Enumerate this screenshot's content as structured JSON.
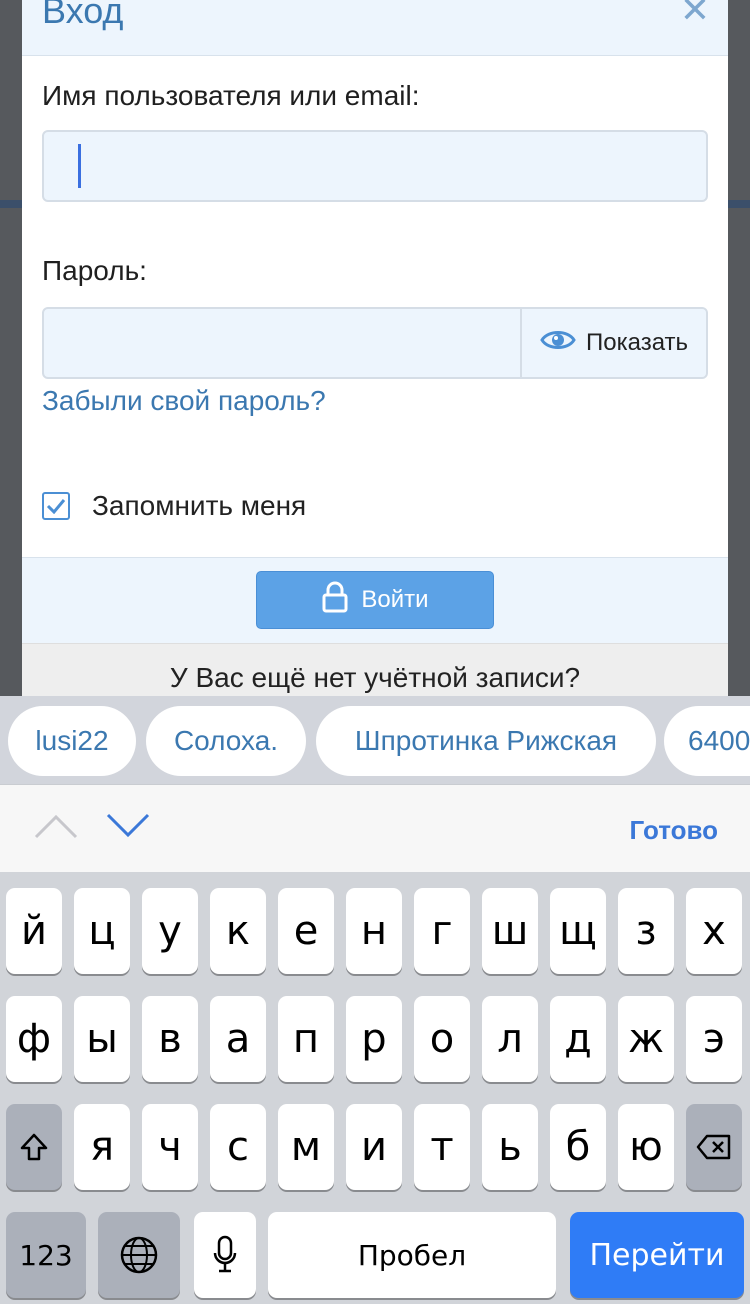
{
  "modal": {
    "title": "Вход",
    "close_icon": "close-icon",
    "username_label": "Имя пользователя или email:",
    "username_value": "",
    "password_label": "Пароль:",
    "password_value": "",
    "show_password_label": "Показать",
    "show_password_icon": "eye-icon",
    "forgot_password_link": "Забыли свой пароль?",
    "remember_me_label": "Запомнить меня",
    "remember_me_checked": true,
    "login_button_label": "Войти",
    "login_button_icon": "lock-icon",
    "register_prompt": "У Вас ещё нет учётной записи?",
    "accent_color": "#3b78b0",
    "button_color": "#5ca2e6"
  },
  "autofill_suggestions": [
    "lusi22",
    "Солоха.",
    "Шпротинка Рижская",
    "6400"
  ],
  "keyboard_accessory": {
    "prev_icon": "chevron-up-icon",
    "next_icon": "chevron-down-icon",
    "done_label": "Готово"
  },
  "keyboard": {
    "row1": [
      "й",
      "ц",
      "у",
      "к",
      "е",
      "н",
      "г",
      "ш",
      "щ",
      "з",
      "х"
    ],
    "row2": [
      "ф",
      "ы",
      "в",
      "а",
      "п",
      "р",
      "о",
      "л",
      "д",
      "ж",
      "э"
    ],
    "row3": [
      "я",
      "ч",
      "с",
      "м",
      "и",
      "т",
      "ь",
      "б",
      "ю"
    ],
    "shift_icon": "shift-icon",
    "backspace_icon": "backspace-icon",
    "numbers_label": "123",
    "globe_icon": "globe-icon",
    "mic_icon": "microphone-icon",
    "space_label": "Пробел",
    "go_label": "Перейти",
    "go_color": "#2f7cf6"
  }
}
